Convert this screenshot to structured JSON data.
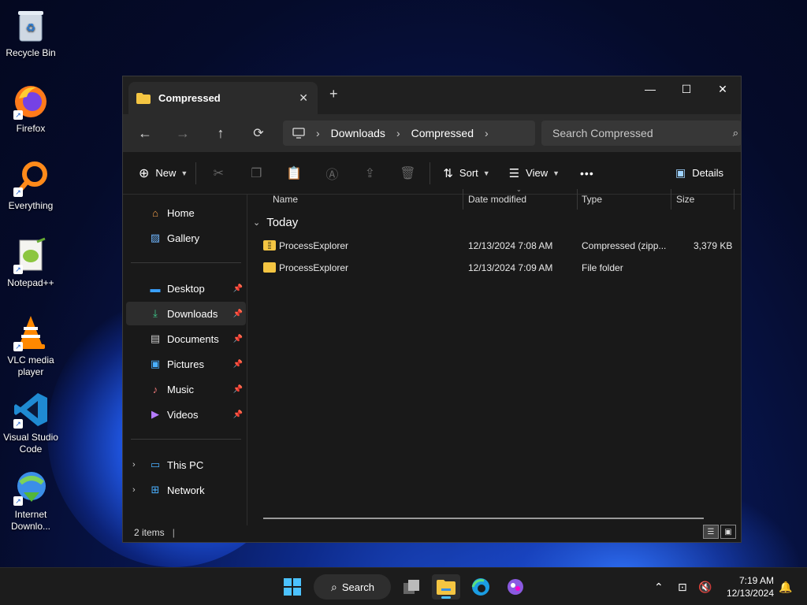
{
  "desktop": {
    "icons": [
      {
        "label": "Recycle Bin",
        "icon": "recycle-bin-icon"
      },
      {
        "label": "Firefox",
        "icon": "firefox-icon"
      },
      {
        "label": "Everything",
        "icon": "everything-search-icon"
      },
      {
        "label": "Notepad++",
        "icon": "notepad-plus-plus-icon"
      },
      {
        "label": "VLC media player",
        "icon": "vlc-cone-icon"
      },
      {
        "label": "Visual Studio Code",
        "icon": "vscode-icon"
      },
      {
        "label": "Internet Downlo...",
        "icon": "internet-download-manager-icon"
      }
    ]
  },
  "window": {
    "tab_title": "Compressed",
    "breadcrumb": [
      "Downloads",
      "Compressed"
    ],
    "search_placeholder": "Search Compressed",
    "toolbar": {
      "new_label": "New",
      "sort_label": "Sort",
      "view_label": "View",
      "more_label": "•••",
      "details_label": "Details"
    },
    "sidebar": {
      "top": [
        "Home",
        "Gallery"
      ],
      "quick": [
        {
          "label": "Desktop",
          "pinned": true
        },
        {
          "label": "Downloads",
          "pinned": true,
          "active": true
        },
        {
          "label": "Documents",
          "pinned": true
        },
        {
          "label": "Pictures",
          "pinned": true
        },
        {
          "label": "Music",
          "pinned": true
        },
        {
          "label": "Videos",
          "pinned": true
        }
      ],
      "bottom": [
        "This PC",
        "Network"
      ]
    },
    "columns": [
      "Name",
      "Date modified",
      "Type",
      "Size"
    ],
    "group": "Today",
    "files": [
      {
        "name": "ProcessExplorer",
        "date": "12/13/2024 7:08 AM",
        "type": "Compressed (zipp...",
        "size": "3,379 KB",
        "kind": "zip"
      },
      {
        "name": "ProcessExplorer",
        "date": "12/13/2024 7:09 AM",
        "type": "File folder",
        "size": "",
        "kind": "folder"
      }
    ],
    "status": "2 items"
  },
  "taskbar": {
    "search_label": "Search",
    "time": "7:19 AM",
    "date": "12/13/2024"
  },
  "colors": {
    "accent": "#4cc2ff",
    "folder": "#f4c542",
    "window_bg": "#191919"
  }
}
